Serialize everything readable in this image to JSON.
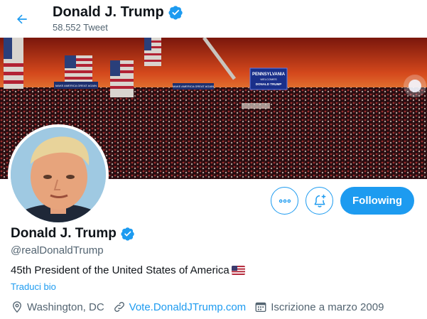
{
  "header": {
    "name": "Donald J. Trump",
    "tweet_count": "58.552 Tweet",
    "back_icon": "arrow-left-icon",
    "verified_icon": "verified-badge-icon"
  },
  "banner": {
    "sign_main": "PENNSYLVANIA",
    "sign_sub": "WELCOMES",
    "sign_bottom": "DONALD TRUMP",
    "banner_left": "MAKE AMERICA GREAT AGAIN",
    "banner_mid": "MAKE AMERICA GREAT AGAIN"
  },
  "actions": {
    "more_icon": "more-options-icon",
    "notify_icon": "bell-plus-icon",
    "following_label": "Following"
  },
  "profile": {
    "name": "Donald J. Trump",
    "handle": "@realDonaldTrump",
    "bio": "45th President of the United States of America",
    "translate_label": "Traduci bio",
    "location": "Washington, DC",
    "website": "Vote.DonaldJTrump.com",
    "joined": "Iscrizione a marzo 2009"
  },
  "colors": {
    "accent": "#1d9bf0",
    "text_primary": "#0f1419",
    "text_secondary": "#536471"
  }
}
